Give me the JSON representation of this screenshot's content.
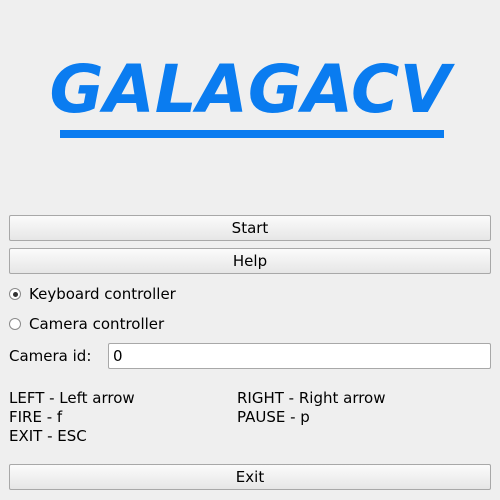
{
  "header": {
    "title": "GALAGACV",
    "accent_color": "#0a7cf0"
  },
  "buttons": {
    "start": "Start",
    "help": "Help",
    "exit": "Exit"
  },
  "controller": {
    "options": [
      {
        "label": "Keyboard controller",
        "checked": true
      },
      {
        "label": "Camera controller",
        "checked": false
      }
    ]
  },
  "camera": {
    "label": "Camera id:",
    "value": "0"
  },
  "controls": {
    "left": "LEFT - Left arrow",
    "right": "RIGHT - Right arrow",
    "fire": "FIRE - f",
    "pause": "PAUSE - p",
    "exit": "EXIT - ESC"
  }
}
